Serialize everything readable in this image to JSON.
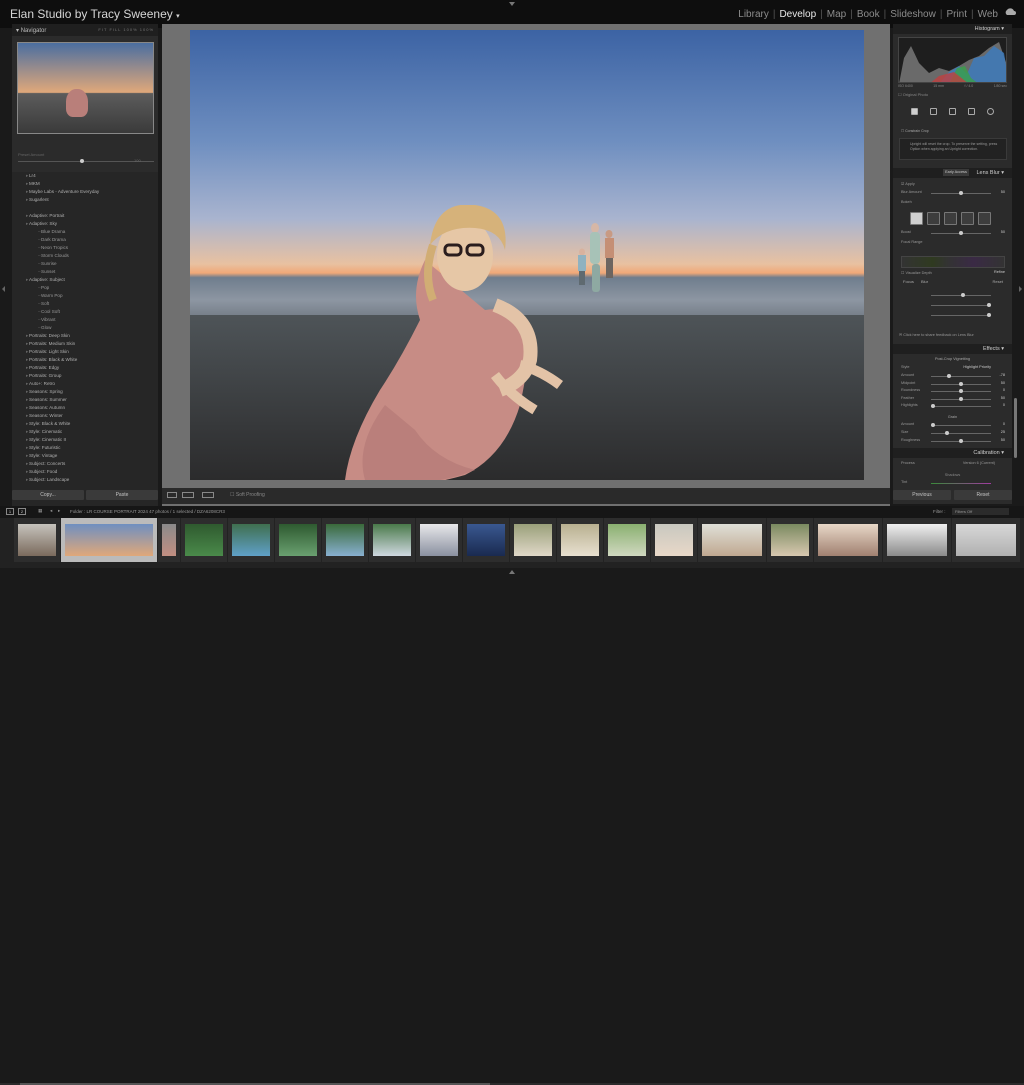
{
  "header": {
    "studio_name": "Elan Studio by Tracy Sweeney",
    "modules": [
      "Library",
      "Develop",
      "Map",
      "Book",
      "Slideshow",
      "Print",
      "Web"
    ],
    "active_module": "Develop"
  },
  "navigator": {
    "title": "Navigator",
    "zoom_options": "FIT  FILL  100%  100%"
  },
  "preset_amount": {
    "label": "Preset Amount",
    "sub": "Amount",
    "value": "100"
  },
  "presets": [
    {
      "label": "Lr4",
      "level": 1
    },
    {
      "label": "MKM",
      "level": 1
    },
    {
      "label": "Maybe Labs - Adventure Everyday",
      "level": 1
    },
    {
      "label": "Sugarlent",
      "level": 1
    },
    {
      "label": "",
      "level": 0
    },
    {
      "label": "Adaptive: Portrait",
      "level": 1
    },
    {
      "label": "Adaptive: Sky",
      "level": 1
    },
    {
      "label": "Blue Drama",
      "level": 2
    },
    {
      "label": "Dark Drama",
      "level": 2
    },
    {
      "label": "Neon Tropics",
      "level": 2
    },
    {
      "label": "Storm Clouds",
      "level": 2
    },
    {
      "label": "Sunrise",
      "level": 2
    },
    {
      "label": "Sunset",
      "level": 2
    },
    {
      "label": "Adaptive: Subject",
      "level": 1
    },
    {
      "label": "Pop",
      "level": 2
    },
    {
      "label": "Warm Pop",
      "level": 2
    },
    {
      "label": "Soft",
      "level": 2
    },
    {
      "label": "Cool Soft",
      "level": 2
    },
    {
      "label": "Vibrant",
      "level": 2
    },
    {
      "label": "Glow",
      "level": 2
    },
    {
      "label": "Portraits: Deep Skin",
      "level": 1
    },
    {
      "label": "Portraits: Medium Skin",
      "level": 1
    },
    {
      "label": "Portraits: Light Skin",
      "level": 1
    },
    {
      "label": "Portraits: Black & White",
      "level": 1
    },
    {
      "label": "Portraits: Edgy",
      "level": 1
    },
    {
      "label": "Portraits: Group",
      "level": 1
    },
    {
      "label": "Auto+: Retro",
      "level": 1
    },
    {
      "label": "Seasons: Spring",
      "level": 1
    },
    {
      "label": "Seasons: Summer",
      "level": 1
    },
    {
      "label": "Seasons: Autumn",
      "level": 1
    },
    {
      "label": "Seasons: Winter",
      "level": 1
    },
    {
      "label": "Style: Black & White",
      "level": 1
    },
    {
      "label": "Style: Cinematic",
      "level": 1
    },
    {
      "label": "Style: Cinematic II",
      "level": 1
    },
    {
      "label": "Style: Futuristic",
      "level": 1
    },
    {
      "label": "Style: Vintage",
      "level": 1
    },
    {
      "label": "Subject: Concerts",
      "level": 1
    },
    {
      "label": "Subject: Food",
      "level": 1
    },
    {
      "label": "Subject: Landscape",
      "level": 1
    }
  ],
  "left_buttons": {
    "copy": "Copy...",
    "paste": "Paste"
  },
  "toolbar": {
    "soft_proofing": "Soft Proofing"
  },
  "right_panel": {
    "histogram_title": "Histogram",
    "hist_stats": [
      "ISO 6400",
      "15 mm",
      "f / 4.0",
      "1/80 sec"
    ],
    "original_photo": "Original Photo",
    "constrain_crop": "Constrain Crop",
    "upright_info": "Upright will reset the crop. To preserve the setting, press Option when applying an Upright correction.",
    "early_access": "Early Access",
    "lens_blur_title": "Lens Blur",
    "apply": "Apply",
    "blur_amount": {
      "label": "Blur Amount",
      "value": "50"
    },
    "bokeh_label": "Bokeh",
    "boost": {
      "label": "Boost",
      "value": "50"
    },
    "focal_range": "Focal Range",
    "visualize_depth": "Visualize Depth",
    "refine": "Refine",
    "focus": "Focus",
    "blur": "Blur",
    "reset": "Reset",
    "feedback": "Click here to share feedback on Lens Blur",
    "effects_title": "Effects",
    "post_crop": "Post-Crop Vignetting",
    "style": {
      "label": "Style",
      "value": "Highlight Priority"
    },
    "vignette_rows": [
      {
        "label": "Amount",
        "value": "-78"
      },
      {
        "label": "Midpoint",
        "value": "50"
      },
      {
        "label": "Roundness",
        "value": "0"
      },
      {
        "label": "Feather",
        "value": "50"
      },
      {
        "label": "Highlights",
        "value": "0"
      }
    ],
    "grain_title": "Grain",
    "grain_rows": [
      {
        "label": "Amount",
        "value": "0"
      },
      {
        "label": "Size",
        "value": "25"
      },
      {
        "label": "Roughness",
        "value": "50"
      }
    ],
    "calibration_title": "Calibration",
    "process": {
      "label": "Process",
      "value": "Version 6 (Current)"
    },
    "shadows": "Shadows",
    "tint_label": "Tint",
    "previous": "Previous",
    "reset_button": "Reset"
  },
  "filmbar": {
    "info": "Folder : LR COURSE PORTRAIT 2024     47 photos / 1 selected / DZA6208CR3",
    "filter_label": "Filter :",
    "filter_value": "Filters Off",
    "monitor1": "1",
    "monitor2": "2"
  },
  "filmstrip_count": 22
}
